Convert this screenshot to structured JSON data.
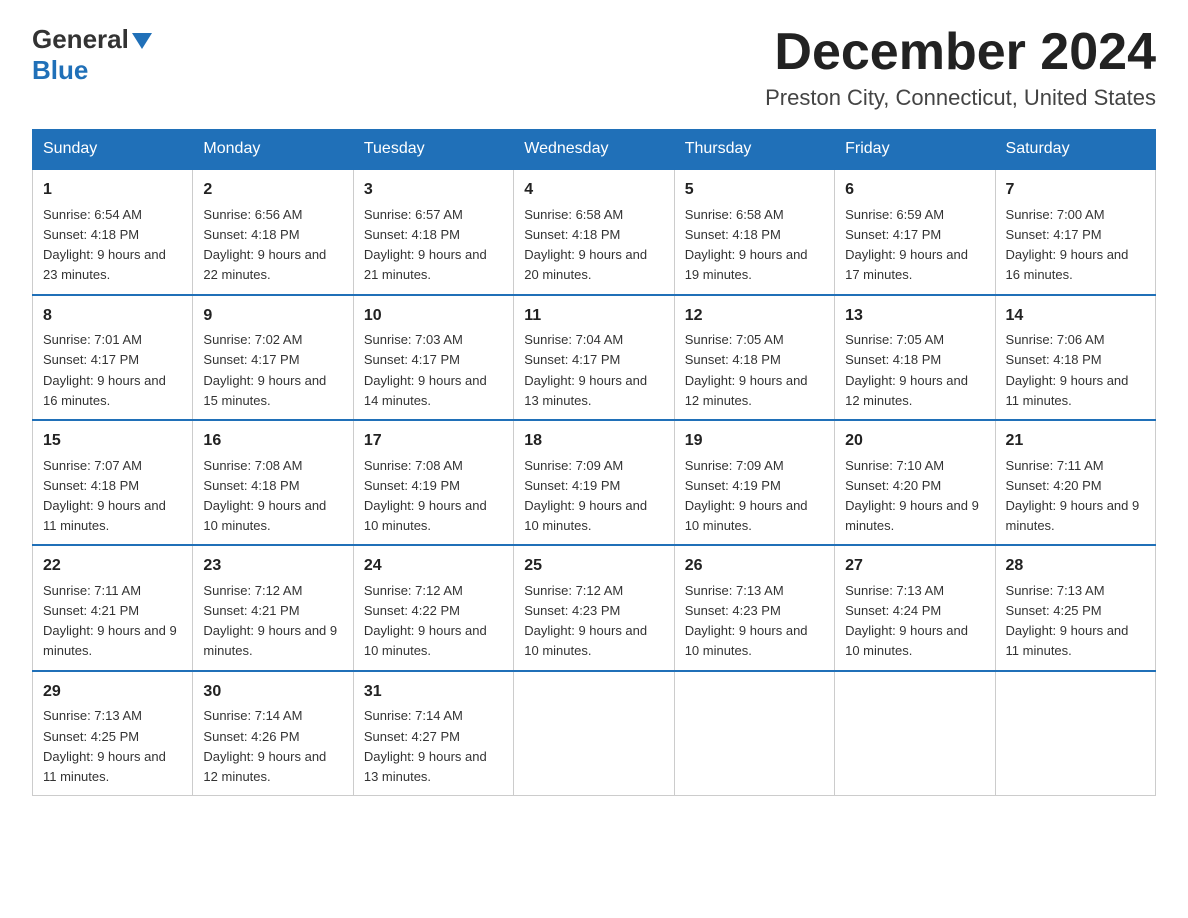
{
  "header": {
    "logo_general": "General",
    "logo_blue": "Blue",
    "month_title": "December 2024",
    "location": "Preston City, Connecticut, United States"
  },
  "weekdays": [
    "Sunday",
    "Monday",
    "Tuesday",
    "Wednesday",
    "Thursday",
    "Friday",
    "Saturday"
  ],
  "weeks": [
    [
      {
        "day": 1,
        "sunrise": "6:54 AM",
        "sunset": "4:18 PM",
        "daylight": "9 hours and 23 minutes."
      },
      {
        "day": 2,
        "sunrise": "6:56 AM",
        "sunset": "4:18 PM",
        "daylight": "9 hours and 22 minutes."
      },
      {
        "day": 3,
        "sunrise": "6:57 AM",
        "sunset": "4:18 PM",
        "daylight": "9 hours and 21 minutes."
      },
      {
        "day": 4,
        "sunrise": "6:58 AM",
        "sunset": "4:18 PM",
        "daylight": "9 hours and 20 minutes."
      },
      {
        "day": 5,
        "sunrise": "6:58 AM",
        "sunset": "4:18 PM",
        "daylight": "9 hours and 19 minutes."
      },
      {
        "day": 6,
        "sunrise": "6:59 AM",
        "sunset": "4:17 PM",
        "daylight": "9 hours and 17 minutes."
      },
      {
        "day": 7,
        "sunrise": "7:00 AM",
        "sunset": "4:17 PM",
        "daylight": "9 hours and 16 minutes."
      }
    ],
    [
      {
        "day": 8,
        "sunrise": "7:01 AM",
        "sunset": "4:17 PM",
        "daylight": "9 hours and 16 minutes."
      },
      {
        "day": 9,
        "sunrise": "7:02 AM",
        "sunset": "4:17 PM",
        "daylight": "9 hours and 15 minutes."
      },
      {
        "day": 10,
        "sunrise": "7:03 AM",
        "sunset": "4:17 PM",
        "daylight": "9 hours and 14 minutes."
      },
      {
        "day": 11,
        "sunrise": "7:04 AM",
        "sunset": "4:17 PM",
        "daylight": "9 hours and 13 minutes."
      },
      {
        "day": 12,
        "sunrise": "7:05 AM",
        "sunset": "4:18 PM",
        "daylight": "9 hours and 12 minutes."
      },
      {
        "day": 13,
        "sunrise": "7:05 AM",
        "sunset": "4:18 PM",
        "daylight": "9 hours and 12 minutes."
      },
      {
        "day": 14,
        "sunrise": "7:06 AM",
        "sunset": "4:18 PM",
        "daylight": "9 hours and 11 minutes."
      }
    ],
    [
      {
        "day": 15,
        "sunrise": "7:07 AM",
        "sunset": "4:18 PM",
        "daylight": "9 hours and 11 minutes."
      },
      {
        "day": 16,
        "sunrise": "7:08 AM",
        "sunset": "4:18 PM",
        "daylight": "9 hours and 10 minutes."
      },
      {
        "day": 17,
        "sunrise": "7:08 AM",
        "sunset": "4:19 PM",
        "daylight": "9 hours and 10 minutes."
      },
      {
        "day": 18,
        "sunrise": "7:09 AM",
        "sunset": "4:19 PM",
        "daylight": "9 hours and 10 minutes."
      },
      {
        "day": 19,
        "sunrise": "7:09 AM",
        "sunset": "4:19 PM",
        "daylight": "9 hours and 10 minutes."
      },
      {
        "day": 20,
        "sunrise": "7:10 AM",
        "sunset": "4:20 PM",
        "daylight": "9 hours and 9 minutes."
      },
      {
        "day": 21,
        "sunrise": "7:11 AM",
        "sunset": "4:20 PM",
        "daylight": "9 hours and 9 minutes."
      }
    ],
    [
      {
        "day": 22,
        "sunrise": "7:11 AM",
        "sunset": "4:21 PM",
        "daylight": "9 hours and 9 minutes."
      },
      {
        "day": 23,
        "sunrise": "7:12 AM",
        "sunset": "4:21 PM",
        "daylight": "9 hours and 9 minutes."
      },
      {
        "day": 24,
        "sunrise": "7:12 AM",
        "sunset": "4:22 PM",
        "daylight": "9 hours and 10 minutes."
      },
      {
        "day": 25,
        "sunrise": "7:12 AM",
        "sunset": "4:23 PM",
        "daylight": "9 hours and 10 minutes."
      },
      {
        "day": 26,
        "sunrise": "7:13 AM",
        "sunset": "4:23 PM",
        "daylight": "9 hours and 10 minutes."
      },
      {
        "day": 27,
        "sunrise": "7:13 AM",
        "sunset": "4:24 PM",
        "daylight": "9 hours and 10 minutes."
      },
      {
        "day": 28,
        "sunrise": "7:13 AM",
        "sunset": "4:25 PM",
        "daylight": "9 hours and 11 minutes."
      }
    ],
    [
      {
        "day": 29,
        "sunrise": "7:13 AM",
        "sunset": "4:25 PM",
        "daylight": "9 hours and 11 minutes."
      },
      {
        "day": 30,
        "sunrise": "7:14 AM",
        "sunset": "4:26 PM",
        "daylight": "9 hours and 12 minutes."
      },
      {
        "day": 31,
        "sunrise": "7:14 AM",
        "sunset": "4:27 PM",
        "daylight": "9 hours and 13 minutes."
      },
      null,
      null,
      null,
      null
    ]
  ],
  "labels": {
    "sunrise": "Sunrise:",
    "sunset": "Sunset:",
    "daylight": "Daylight:"
  }
}
